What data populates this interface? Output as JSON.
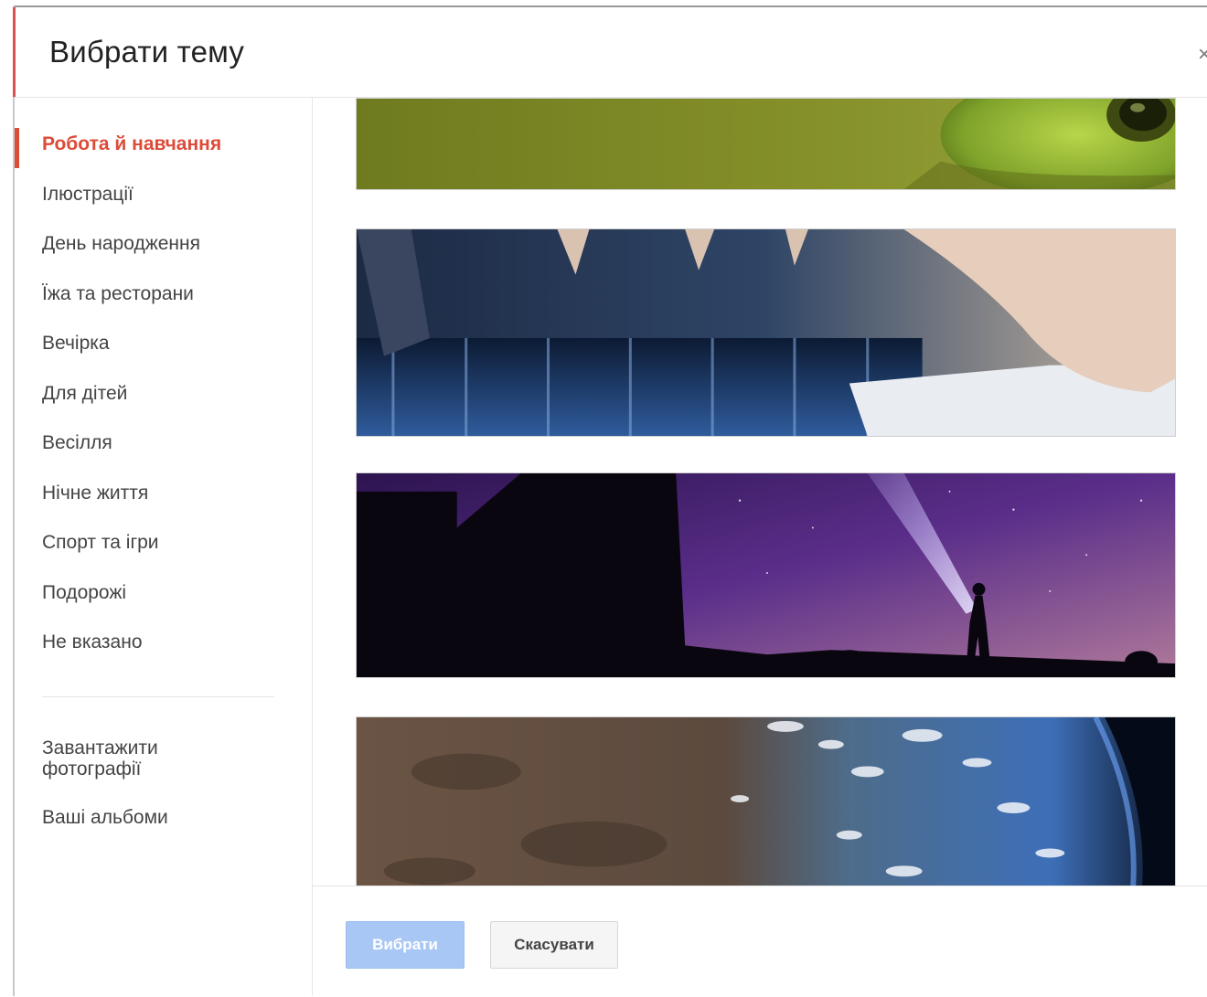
{
  "dialog": {
    "title": "Вибрати тему",
    "close_symbol": "×"
  },
  "sidebar": {
    "categories": [
      {
        "label": "Робота й навчання",
        "active": true
      },
      {
        "label": "Ілюстрації"
      },
      {
        "label": "День народження"
      },
      {
        "label": "Їжа та ресторани"
      },
      {
        "label": "Вечірка"
      },
      {
        "label": "Для дітей"
      },
      {
        "label": "Весілля"
      },
      {
        "label": "Нічне життя"
      },
      {
        "label": "Спорт та ігри"
      },
      {
        "label": "Подорожі"
      },
      {
        "label": "Не вказано"
      }
    ],
    "upload_label": "Завантажити фотографії",
    "albums_label": "Ваші альбоми"
  },
  "themes": [
    {
      "subject": "frog"
    },
    {
      "subject": "piano-hands"
    },
    {
      "subject": "night-sky-flashlight"
    },
    {
      "subject": "earth-from-space"
    }
  ],
  "footer": {
    "select_label": "Вибрати",
    "cancel_label": "Скасувати"
  },
  "colors": {
    "accent": "#dd4b39",
    "primary_button": "#a9c7f4",
    "secondary_button": "#f5f5f5"
  }
}
